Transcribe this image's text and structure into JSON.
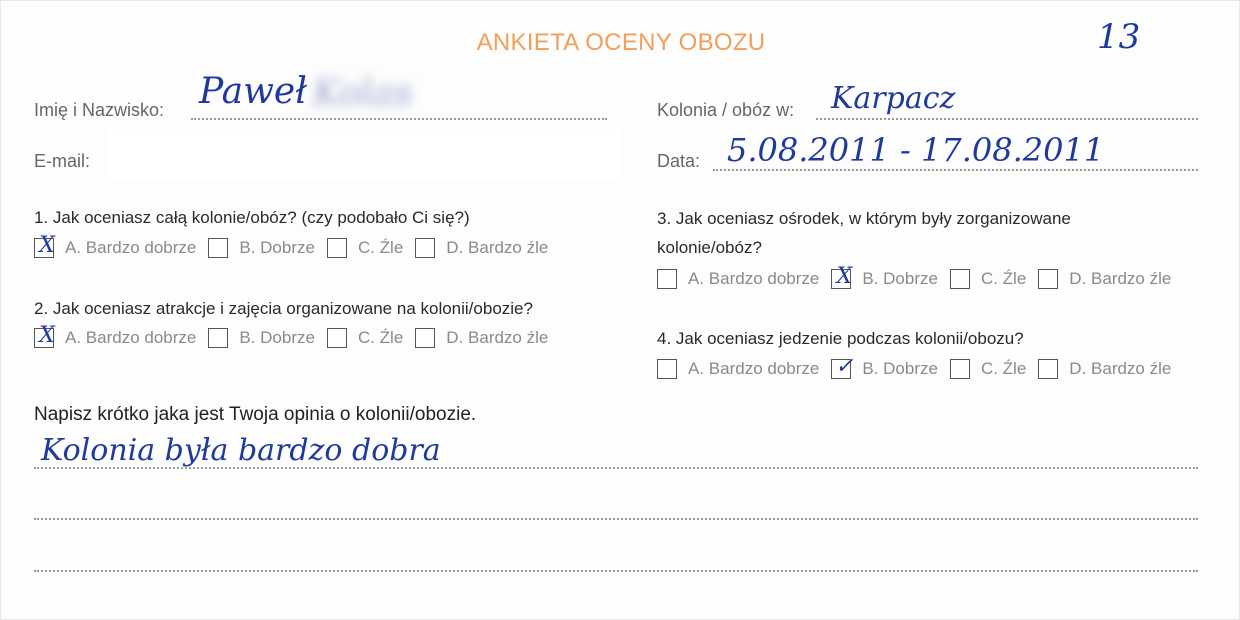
{
  "form": {
    "title": "ANKIETA OCENY OBOZU",
    "number": "13",
    "name_label": "Imię i Nazwisko:",
    "name_value": "Paweł",
    "name_surname_blurred": "Kolas",
    "email_label": "E-mail:",
    "camp_label": "Kolonia / obóz w:",
    "camp_value": "Karpacz",
    "date_label": "Data:",
    "date_value": "5.08.2011 - 17.08.2011"
  },
  "questions": [
    {
      "text": "1. Jak oceniasz całą kolonie/obóz? (czy podobało Ci się?)",
      "options": [
        "A. Bardzo dobrze",
        "B. Dobrze",
        "C. Źle",
        "D. Bardzo źle"
      ],
      "marks": [
        "X",
        "",
        "",
        ""
      ]
    },
    {
      "text": "2.  Jak oceniasz atrakcje i zajęcia organizowane na kolonii/obozie?",
      "options": [
        "A. Bardzo dobrze",
        "B. Dobrze",
        "C. Źle",
        "D. Bardzo źle"
      ],
      "marks": [
        "X",
        "",
        "",
        ""
      ]
    },
    {
      "text_line1": "3. Jak oceniasz ośrodek, w którym były zorganizowane",
      "text_line2": "kolonie/obóz?",
      "options": [
        "A. Bardzo dobrze",
        "B. Dobrze",
        "C. Źle",
        "D. Bardzo źle"
      ],
      "marks": [
        "",
        "X",
        "",
        ""
      ]
    },
    {
      "text": "4.  Jak oceniasz jedzenie podczas kolonii/obozu?",
      "options": [
        "A. Bardzo dobrze",
        "B. Dobrze",
        "C. Źle",
        "D. Bardzo źle"
      ],
      "marks": [
        "",
        "✓",
        "",
        ""
      ]
    }
  ],
  "opinion": {
    "title": "Napisz krótko jaka jest Twoja opinia o kolonii/obozie.",
    "answer": "Kolonia była bardzo dobra"
  },
  "colors": {
    "title_orange": "#f0a05a",
    "ink_blue": "#1f3a9a"
  }
}
